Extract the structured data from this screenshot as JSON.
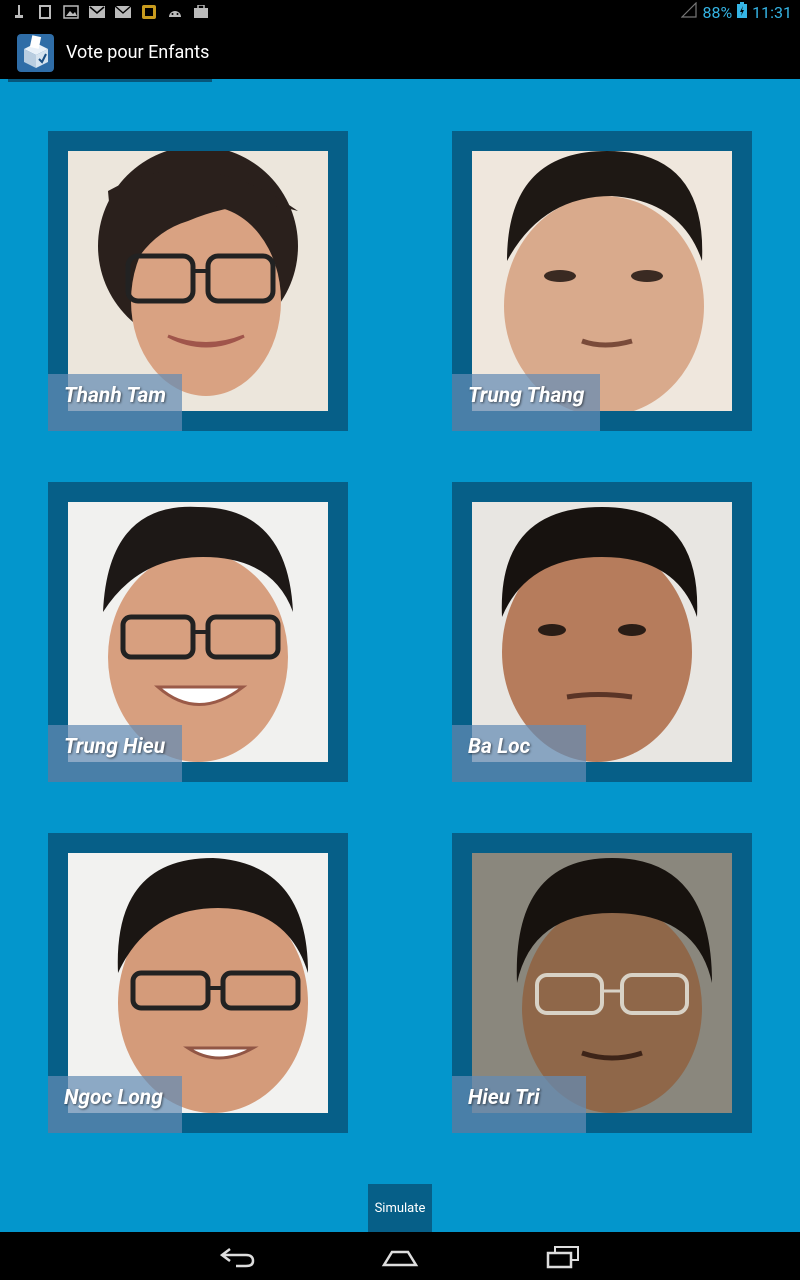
{
  "status_bar": {
    "notification_icons": [
      "usb-icon",
      "sim-icon",
      "image-icon",
      "gmail-icon",
      "mail-icon",
      "app-icon",
      "android-icon",
      "briefcase-icon"
    ],
    "battery": "88%",
    "time": "11:31"
  },
  "action_bar": {
    "title": "Vote pour Enfants",
    "icon": "ballot-box-icon"
  },
  "candidates": [
    {
      "name": "Thanh Tam",
      "photo": "portrait-photo"
    },
    {
      "name": "Trung Thang",
      "photo": "portrait-photo"
    },
    {
      "name": "Trung Hieu",
      "photo": "portrait-photo"
    },
    {
      "name": "Ba Loc",
      "photo": "portrait-photo"
    },
    {
      "name": "Ngoc Long",
      "photo": "portrait-photo"
    },
    {
      "name": "Hieu Tri",
      "photo": "portrait-photo"
    }
  ],
  "simulate_label": "Simulate",
  "nav": {
    "back": "back-icon",
    "home": "home-icon",
    "recents": "recent-apps-icon"
  }
}
